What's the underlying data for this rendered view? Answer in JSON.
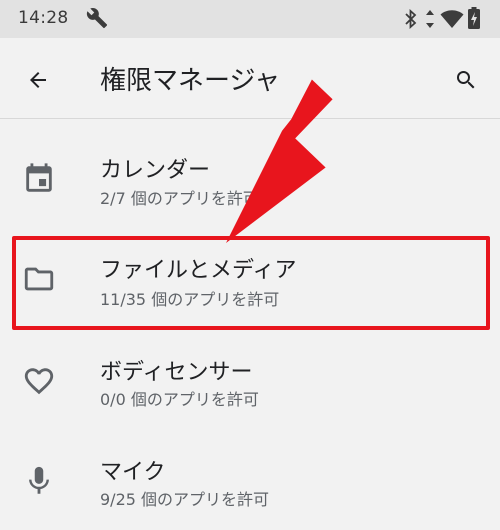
{
  "status_bar": {
    "time": "14:28",
    "icons": [
      "wrench-icon",
      "bluetooth-icon",
      "data-arrows-icon",
      "wifi-icon",
      "battery-charging-icon"
    ]
  },
  "app_bar": {
    "title": "権限マネージャ",
    "back_icon": "arrow-back-icon",
    "search_icon": "search-icon"
  },
  "permissions": [
    {
      "icon": "calendar-icon",
      "title": "カレンダー",
      "summary": "2/7 個のアプリを許可"
    },
    {
      "icon": "folder-icon",
      "title": "ファイルとメディア",
      "summary": "11/35 個のアプリを許可"
    },
    {
      "icon": "heart-icon",
      "title": "ボディセンサー",
      "summary": "0/0 個のアプリを許可"
    },
    {
      "icon": "microphone-icon",
      "title": "マイク",
      "summary": "9/25 個のアプリを許可"
    }
  ],
  "colors": {
    "annotation_red": "#e8151d",
    "background": "#f2f2f2",
    "status_bar": "#e2e2e2"
  }
}
